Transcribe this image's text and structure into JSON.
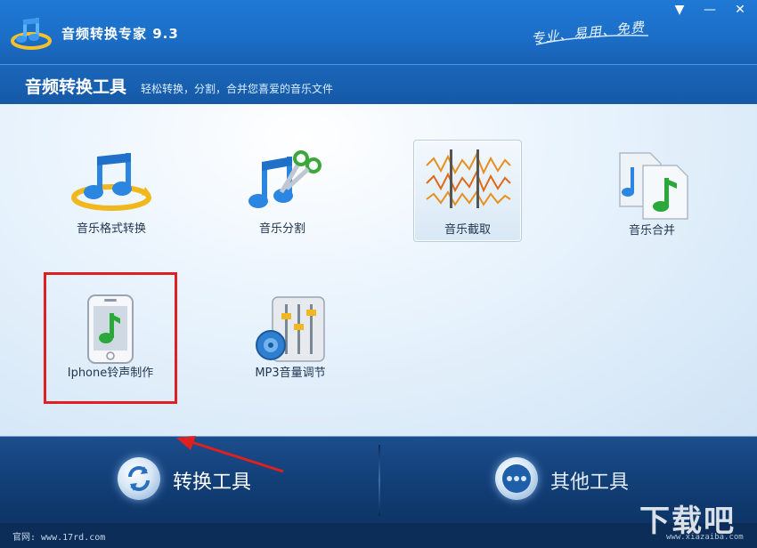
{
  "window": {
    "title": "音频转换专家 9.3",
    "slogan": "专业、易用、免费",
    "controls": {
      "menu": "▼",
      "minimize": "—",
      "close": "✕"
    }
  },
  "header": {
    "title": "音频转换工具",
    "description": "轻松转换，分割，合并您喜爱的音乐文件"
  },
  "tools": [
    {
      "label": "音乐格式转换",
      "icon": "music-convert-icon"
    },
    {
      "label": "音乐分割",
      "icon": "music-split-icon"
    },
    {
      "label": "音乐截取",
      "icon": "music-trim-icon",
      "selected": true
    },
    {
      "label": "音乐合并",
      "icon": "music-merge-icon"
    },
    {
      "label": "Iphone铃声制作",
      "icon": "iphone-ringtone-icon",
      "highlighted": true
    },
    {
      "label": "MP3音量调节",
      "icon": "mp3-volume-icon"
    }
  ],
  "bottom_nav": {
    "convert": {
      "label": "转换工具",
      "icon": "refresh-icon",
      "active": true
    },
    "other": {
      "label": "其他工具",
      "icon": "more-dots-icon",
      "active": false
    }
  },
  "footer": {
    "site": "官网: www.17rd.com"
  },
  "watermark": {
    "text": "下载吧",
    "sub": "www.xiazaiba.com"
  },
  "colors": {
    "highlight_box": "#e02020",
    "arrow": "#e02020",
    "header_blue": "#1c6fc8"
  }
}
